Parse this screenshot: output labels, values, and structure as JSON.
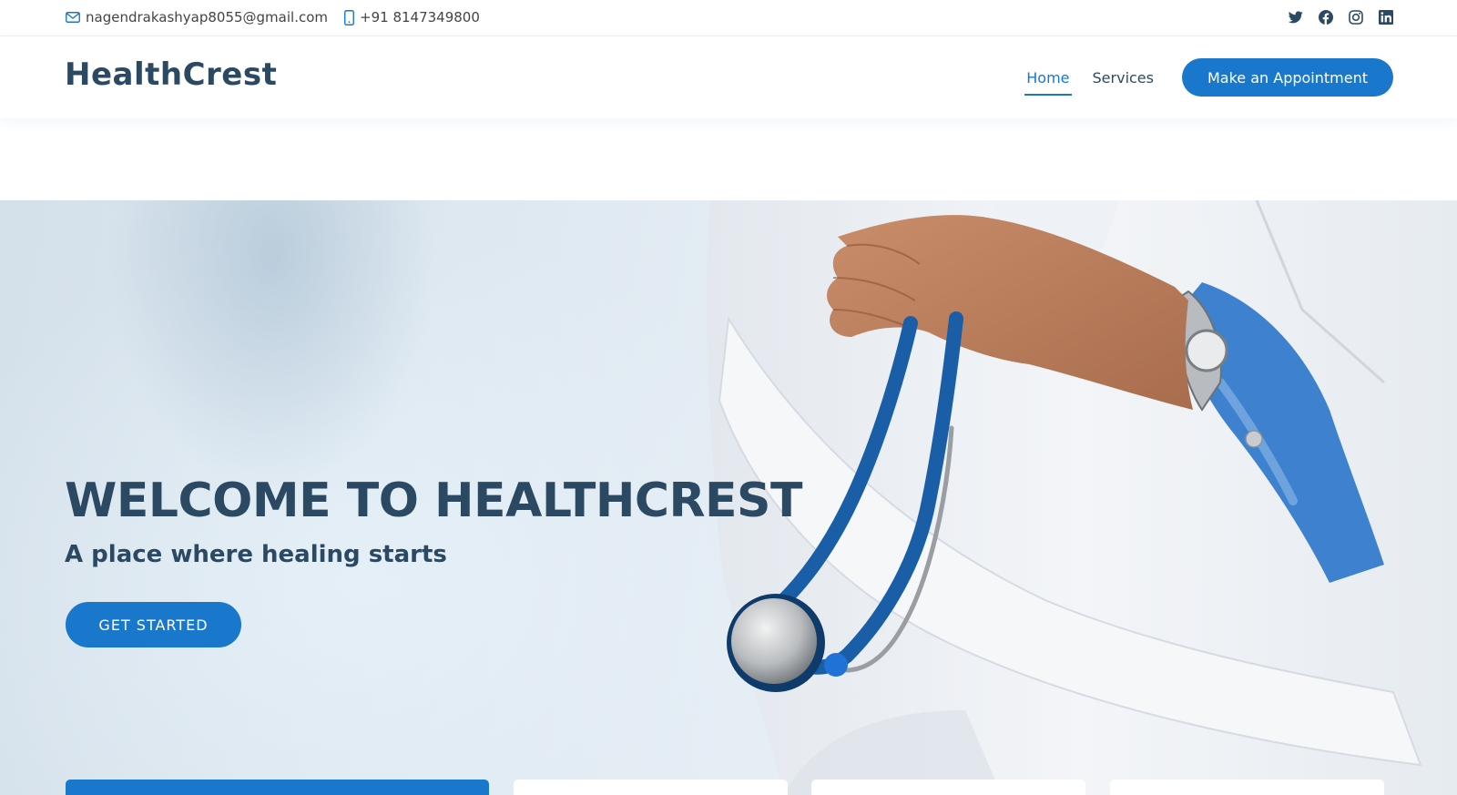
{
  "topbar": {
    "email": "nagendrakashyap8055@gmail.com",
    "phone": "+91 8147349800",
    "icons": {
      "email": "envelope-icon",
      "phone": "phone-icon",
      "social": [
        "twitter-icon",
        "facebook-icon",
        "instagram-icon",
        "linkedin-icon"
      ]
    }
  },
  "header": {
    "logo": "HealthCrest",
    "nav": [
      {
        "label": "Home",
        "active": true
      },
      {
        "label": "Services",
        "active": false
      }
    ],
    "appointment_label": "Make an Appointment"
  },
  "hero": {
    "title": "WELCOME TO HEALTHCREST",
    "subtitle": "A place where healing starts",
    "cta_label": "GET STARTED"
  },
  "colors": {
    "accent": "#1977cc",
    "heading": "#2c4964",
    "text": "#444444",
    "hero_bg": "#dfe9f1"
  }
}
